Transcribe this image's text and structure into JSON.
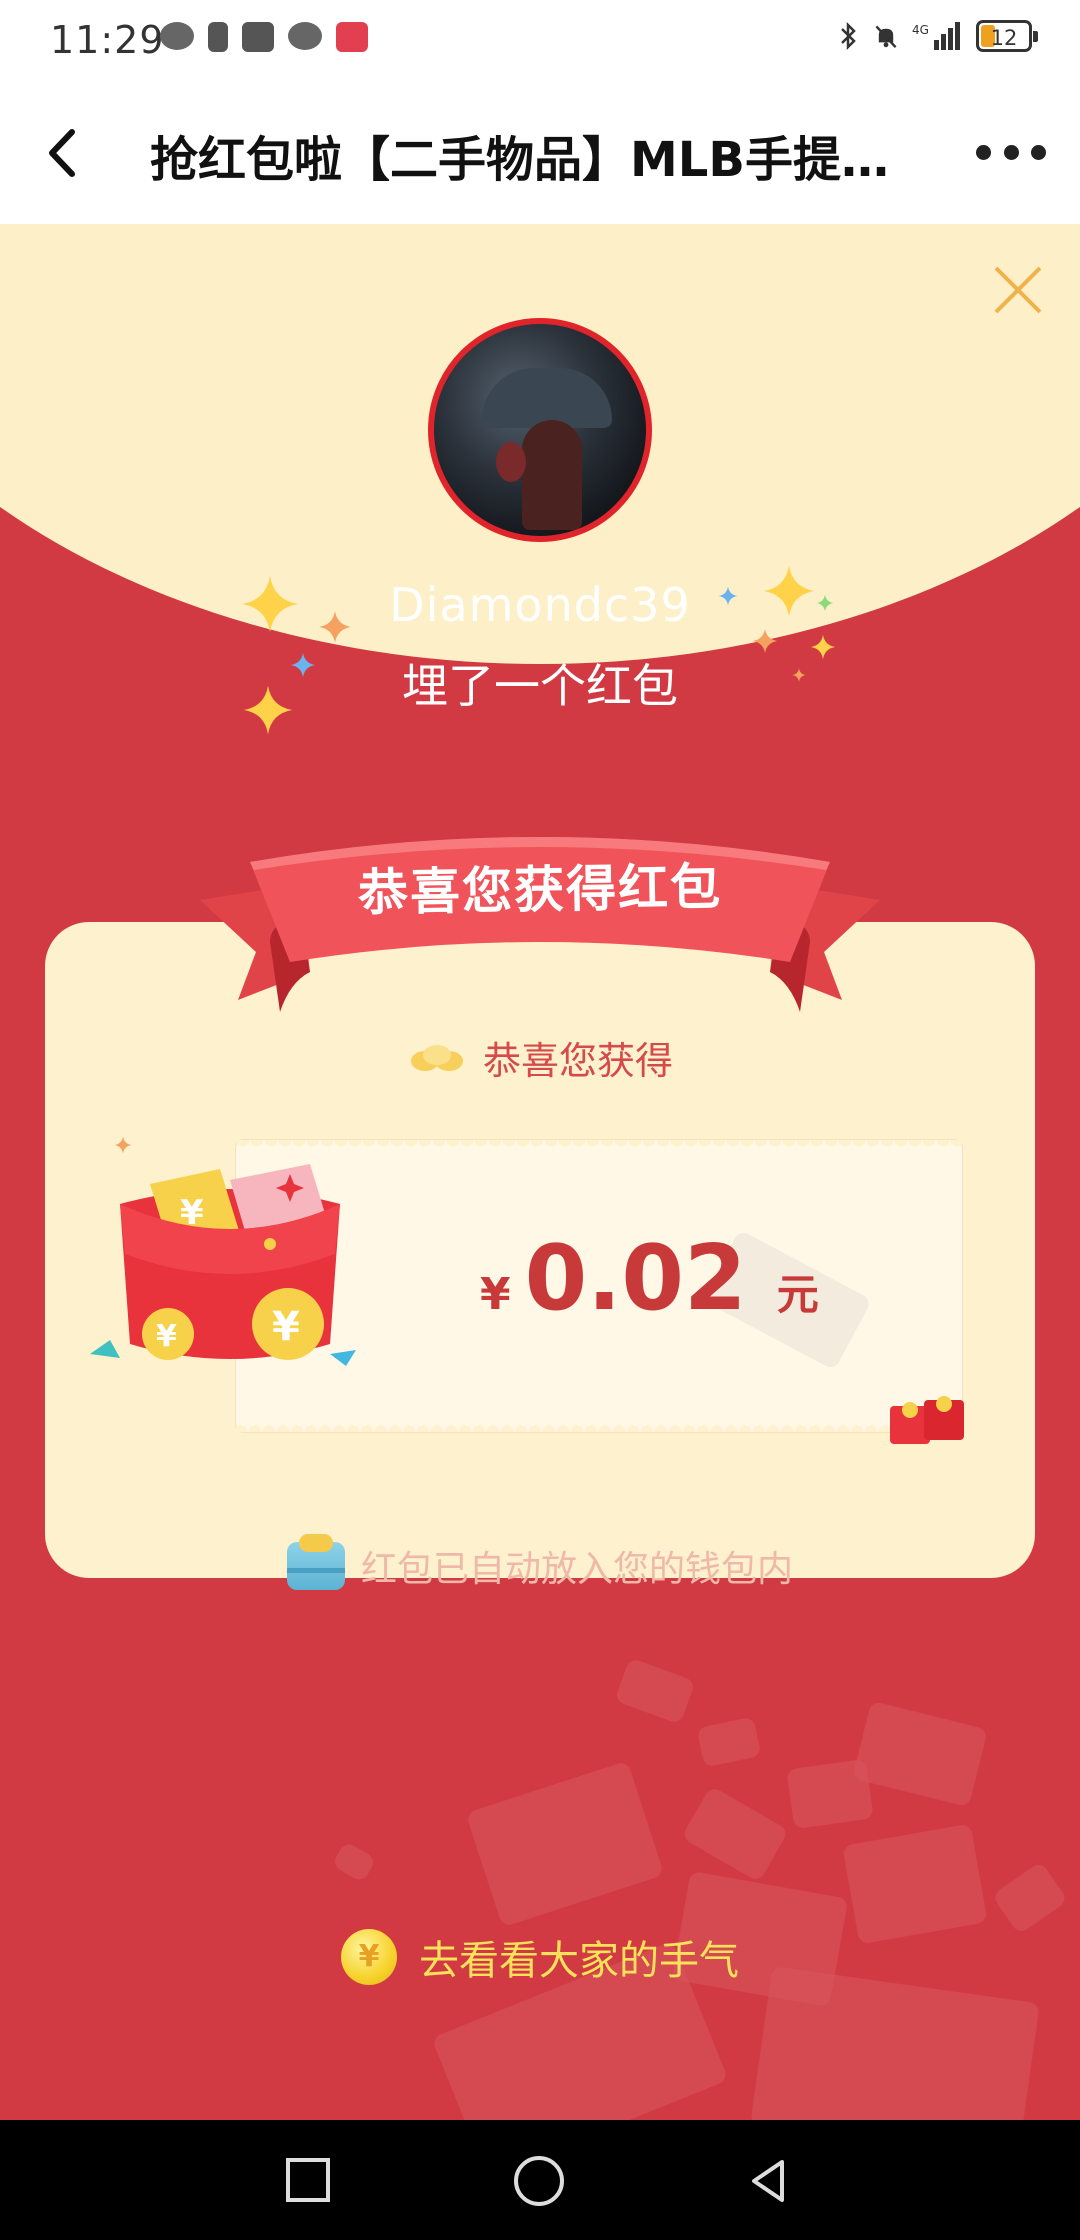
{
  "status_bar": {
    "time": "11:29",
    "battery_level": "12",
    "left_icons": [
      "wechat-icon",
      "alert-icon",
      "huawei-icon",
      "wechat-icon",
      "book-icon"
    ],
    "right_icons": [
      "bluetooth-icon",
      "mute-bell-icon",
      "signal-4g-icon",
      "battery-icon"
    ]
  },
  "title_bar": {
    "title": "抢红包啦【二手物品】MLB手提…",
    "back_icon": "chevron-left-icon",
    "more_icon": "more-dots-icon"
  },
  "envelope": {
    "close_icon": "close-icon",
    "username": "Diamondc39",
    "subtitle": "埋了一个红包",
    "ribbon_text": "恭喜您获得红包",
    "received_label": "恭喜您获得",
    "currency": "¥",
    "amount": "0.02",
    "unit": "元",
    "wallet_notice": "红包已自动放入您的钱包内",
    "see_luck_label": "去看看大家的手气"
  },
  "colors": {
    "background_red": "#d13a43",
    "cream": "#fdf1ce",
    "amount_red": "#c83a3a",
    "gold_text": "#fbe25a"
  },
  "nav_bar": {
    "buttons": [
      "recent-apps-icon",
      "home-icon",
      "back-icon"
    ]
  }
}
